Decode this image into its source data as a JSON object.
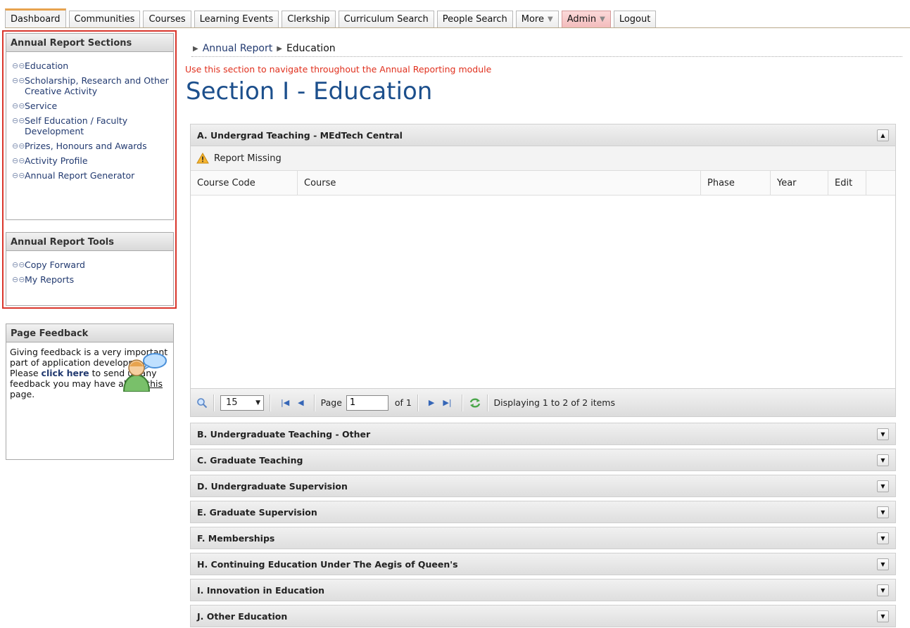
{
  "nav": {
    "tabs": [
      {
        "label": "Dashboard"
      },
      {
        "label": "Communities"
      },
      {
        "label": "Courses"
      },
      {
        "label": "Learning Events"
      },
      {
        "label": "Clerkship"
      },
      {
        "label": "Curriculum Search"
      },
      {
        "label": "People Search"
      },
      {
        "label": "More"
      },
      {
        "label": "Admin"
      },
      {
        "label": "Logout"
      }
    ],
    "active_tab": "Dashboard",
    "accent_color": "#e7a34e",
    "admin_color": "#f3bcbc"
  },
  "sidebar": {
    "sections_title": "Annual Report Sections",
    "sections": [
      {
        "label": "Education"
      },
      {
        "label": "Scholarship, Research and Other Creative Activity"
      },
      {
        "label": "Service"
      },
      {
        "label": "Self Education / Faculty Development"
      },
      {
        "label": "Prizes, Honours and Awards"
      },
      {
        "label": "Activity Profile"
      },
      {
        "label": "Annual Report Generator"
      }
    ],
    "tools_title": "Annual Report Tools",
    "tools": [
      {
        "label": "Copy Forward"
      },
      {
        "label": "My Reports"
      }
    ],
    "feedback": {
      "title": "Page Feedback",
      "text_before": "Giving feedback is a very important part of application development. Please ",
      "link": "click here",
      "text_middle": " to send us any feedback you may have about ",
      "this_link": "this",
      "text_after": " page."
    }
  },
  "breadcrumb": {
    "parent": "Annual Report",
    "current": "Education"
  },
  "note": "Use this section to navigate throughout the Annual Reporting module",
  "page_title": "Section I - Education",
  "section_a": {
    "title": "A. Undergrad Teaching - MEdTech Central",
    "status": "Report Missing",
    "columns": [
      "Course Code",
      "Course",
      "Phase",
      "Year",
      "Edit"
    ],
    "pager": {
      "per_page": "15",
      "page_label": "Page",
      "page_value": "1",
      "of_label": "of 1",
      "display": "Displaying 1 to 2 of 2 items"
    }
  },
  "other_sections": [
    {
      "title": "B. Undergraduate Teaching - Other"
    },
    {
      "title": "C. Graduate Teaching"
    },
    {
      "title": "D. Undergraduate Supervision"
    },
    {
      "title": "E. Graduate Supervision"
    },
    {
      "title": "F. Memberships"
    },
    {
      "title": "H. Continuing Education Under The Aegis of Queen's"
    },
    {
      "title": "I. Innovation in Education"
    },
    {
      "title": "J. Other Education"
    }
  ]
}
